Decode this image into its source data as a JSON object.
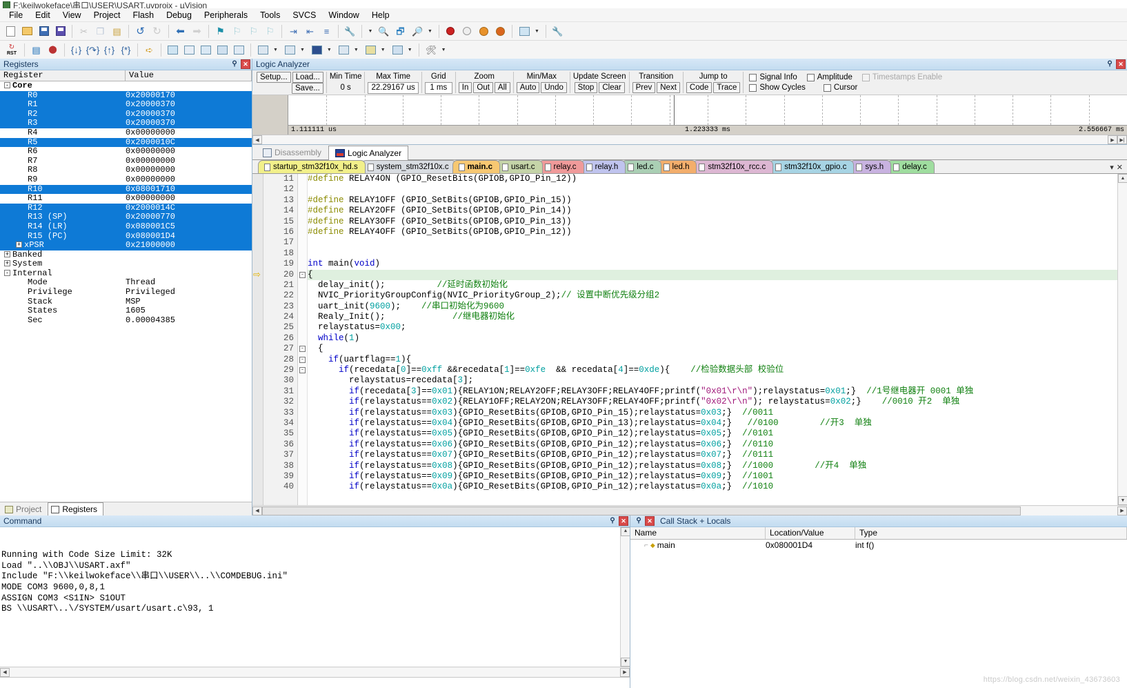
{
  "window": {
    "title": "F:\\keilwokeface\\串口\\USER\\USART.uvprojx - µVision",
    "logo_icon": "keil-logo-icon"
  },
  "menu": {
    "items": [
      {
        "label": "File"
      },
      {
        "label": "Edit"
      },
      {
        "label": "View"
      },
      {
        "label": "Project"
      },
      {
        "label": "Flash"
      },
      {
        "label": "Debug"
      },
      {
        "label": "Peripherals"
      },
      {
        "label": "Tools"
      },
      {
        "label": "SVCS"
      },
      {
        "label": "Window"
      },
      {
        "label": "Help"
      }
    ]
  },
  "toolbar_main": {
    "buttons": [
      {
        "name": "new-file-icon",
        "glyph": "doc"
      },
      {
        "name": "open-file-icon",
        "glyph": "folder"
      },
      {
        "name": "save-icon",
        "glyph": "save"
      },
      {
        "name": "save-all-icon",
        "glyph": "saveall"
      },
      {
        "name": "cut-icon",
        "glyph": "cut"
      },
      {
        "name": "copy-icon",
        "glyph": "copy"
      },
      {
        "name": "paste-icon",
        "glyph": "paste"
      },
      {
        "name": "undo-icon",
        "glyph": "undo"
      },
      {
        "name": "redo-icon",
        "glyph": "redo"
      },
      {
        "name": "navigate-back-icon",
        "glyph": "back"
      },
      {
        "name": "navigate-forward-icon",
        "glyph": "forward"
      },
      {
        "name": "bookmark-toggle-icon",
        "glyph": "flag"
      },
      {
        "name": "bookmark-prev-icon",
        "glyph": "flagprev"
      },
      {
        "name": "bookmark-next-icon",
        "glyph": "flagnext"
      },
      {
        "name": "bookmark-clear-icon",
        "glyph": "flagclear"
      },
      {
        "name": "indent-icon",
        "glyph": "indent"
      },
      {
        "name": "outdent-icon",
        "glyph": "outdent"
      },
      {
        "name": "comment-icon",
        "glyph": "comment"
      },
      {
        "name": "configure-icon",
        "glyph": "cfg"
      },
      {
        "name": "find-in-files-icon",
        "glyph": "findfiles"
      },
      {
        "name": "browse-icon",
        "glyph": "browse"
      },
      {
        "name": "find-icon",
        "glyph": "find"
      },
      {
        "name": "insert-breakpoint-icon",
        "glyph": "bpred"
      },
      {
        "name": "disable-breakpoint-icon",
        "glyph": "bpgray"
      },
      {
        "name": "disable-all-breakpoints-icon",
        "glyph": "bporange1"
      },
      {
        "name": "kill-all-breakpoints-icon",
        "glyph": "bporange2"
      },
      {
        "name": "debug-window-icon",
        "glyph": "dbgwin"
      },
      {
        "name": "configure-target-icon",
        "glyph": "wrench"
      }
    ]
  },
  "toolbar_debug": {
    "buttons": [
      {
        "name": "reset-cpu-icon",
        "glyph": "rst",
        "label": "RST"
      },
      {
        "name": "run-icon",
        "glyph": "run"
      },
      {
        "name": "stop-icon",
        "glyph": "stop"
      },
      {
        "name": "step-icon",
        "glyph": "step"
      },
      {
        "name": "step-over-icon",
        "glyph": "stepover"
      },
      {
        "name": "step-out-icon",
        "glyph": "stepout"
      },
      {
        "name": "run-to-cursor-icon",
        "glyph": "runtocursor"
      },
      {
        "name": "show-next-statement-icon",
        "glyph": "nextstmt"
      },
      {
        "name": "command-window-icon",
        "glyph": "cmdwin"
      },
      {
        "name": "disassembly-window-icon",
        "glyph": "disasm"
      },
      {
        "name": "symbols-window-icon",
        "glyph": "symbols"
      },
      {
        "name": "registers-window-icon",
        "glyph": "regs"
      },
      {
        "name": "call-stack-window-icon",
        "glyph": "callstack"
      },
      {
        "name": "watch-windows-icon",
        "glyph": "watch"
      },
      {
        "name": "memory-windows-icon",
        "glyph": "memory"
      },
      {
        "name": "serial-windows-icon",
        "glyph": "serial"
      },
      {
        "name": "analysis-windows-icon",
        "glyph": "analysis"
      },
      {
        "name": "trace-windows-icon",
        "glyph": "trace"
      },
      {
        "name": "system-viewer-icon",
        "glyph": "sysview"
      },
      {
        "name": "toolbox-icon",
        "glyph": "toolbox"
      }
    ]
  },
  "registers_panel": {
    "title": "Registers",
    "columns": [
      "Register",
      "Value"
    ],
    "rows": [
      {
        "name": "Core",
        "value": "",
        "level": 0,
        "toggle": "-",
        "selected": false,
        "bold": true
      },
      {
        "name": "R0",
        "value": "0x20000170",
        "level": 2,
        "selected": true
      },
      {
        "name": "R1",
        "value": "0x20000370",
        "level": 2,
        "selected": true
      },
      {
        "name": "R2",
        "value": "0x20000370",
        "level": 2,
        "selected": true
      },
      {
        "name": "R3",
        "value": "0x20000370",
        "level": 2,
        "selected": true
      },
      {
        "name": "R4",
        "value": "0x00000000",
        "level": 2,
        "selected": false
      },
      {
        "name": "R5",
        "value": "0x2000010C",
        "level": 2,
        "selected": true
      },
      {
        "name": "R6",
        "value": "0x00000000",
        "level": 2,
        "selected": false
      },
      {
        "name": "R7",
        "value": "0x00000000",
        "level": 2,
        "selected": false
      },
      {
        "name": "R8",
        "value": "0x00000000",
        "level": 2,
        "selected": false
      },
      {
        "name": "R9",
        "value": "0x00000000",
        "level": 2,
        "selected": false
      },
      {
        "name": "R10",
        "value": "0x08001710",
        "level": 2,
        "selected": true
      },
      {
        "name": "R11",
        "value": "0x00000000",
        "level": 2,
        "selected": false
      },
      {
        "name": "R12",
        "value": "0x2000014C",
        "level": 2,
        "selected": true
      },
      {
        "name": "R13 (SP)",
        "value": "0x20000770",
        "level": 2,
        "selected": true
      },
      {
        "name": "R14 (LR)",
        "value": "0x080001C5",
        "level": 2,
        "selected": true
      },
      {
        "name": "R15 (PC)",
        "value": "0x080001D4",
        "level": 2,
        "selected": true
      },
      {
        "name": "xPSR",
        "value": "0x21000000",
        "level": 1,
        "toggle": "+",
        "selected": true
      },
      {
        "name": "Banked",
        "value": "",
        "level": 0,
        "toggle": "+",
        "selected": false
      },
      {
        "name": "System",
        "value": "",
        "level": 0,
        "toggle": "+",
        "selected": false
      },
      {
        "name": "Internal",
        "value": "",
        "level": 0,
        "toggle": "-",
        "selected": false
      },
      {
        "name": "Mode",
        "value": "Thread",
        "level": 2,
        "selected": false
      },
      {
        "name": "Privilege",
        "value": "Privileged",
        "level": 2,
        "selected": false
      },
      {
        "name": "Stack",
        "value": "MSP",
        "level": 2,
        "selected": false
      },
      {
        "name": "States",
        "value": "1605",
        "level": 2,
        "selected": false
      },
      {
        "name": "Sec",
        "value": "0.00004385",
        "level": 2,
        "selected": false
      }
    ],
    "tabs": [
      {
        "label": "Project",
        "icon": "project-icon",
        "active": false
      },
      {
        "label": "Registers",
        "icon": "registers-icon",
        "active": true
      }
    ]
  },
  "logic_analyzer": {
    "title": "Logic Analyzer",
    "setup_button": "Setup...",
    "load_button": "Load...",
    "save_button": "Save...",
    "min_time_label": "Min Time",
    "min_time_value": "0 s",
    "max_time_label": "Max Time",
    "max_time_value": "22.29167 us",
    "grid_label": "Grid",
    "grid_value": "1 ms",
    "zoom_label": "Zoom",
    "zoom_buttons": [
      "In",
      "Out",
      "All"
    ],
    "minmax_label": "Min/Max",
    "minmax_buttons": [
      "Auto",
      "Undo"
    ],
    "update_screen_label": "Update Screen",
    "update_screen_buttons": [
      "Stop",
      "Clear"
    ],
    "transition_label": "Transition",
    "transition_buttons": [
      "Prev",
      "Next"
    ],
    "jumpto_label": "Jump to",
    "jumpto_buttons": [
      "Code",
      "Trace"
    ],
    "checkboxes": [
      {
        "label": "Signal Info",
        "checked": false,
        "disabled": false
      },
      {
        "label": "Show Cycles",
        "checked": false,
        "disabled": false
      },
      {
        "label": "Amplitude",
        "checked": false,
        "disabled": false
      },
      {
        "label": "Cursor",
        "checked": false,
        "disabled": false
      },
      {
        "label": "Timestamps Enable",
        "checked": false,
        "disabled": true
      }
    ],
    "ruler": {
      "left": "1.111111 us",
      "middle": "1.223333 ms",
      "right": "2.556667 ms"
    }
  },
  "editor": {
    "view_tabs": [
      {
        "label": "Disassembly",
        "icon": "disassembly-icon",
        "active": false
      },
      {
        "label": "Logic Analyzer",
        "icon": "logic-analyzer-icon",
        "active": true
      }
    ],
    "file_tabs": [
      {
        "label": "startup_stm32f10x_hd.s",
        "color": "#f2f08a",
        "active": false
      },
      {
        "label": "system_stm32f10x.c",
        "color": "#d9dde2",
        "active": false
      },
      {
        "label": "main.c",
        "color": "#f7c872",
        "active": true
      },
      {
        "label": "usart.c",
        "color": "#c5d4a8",
        "active": false
      },
      {
        "label": "relay.c",
        "color": "#f09a9a",
        "active": false
      },
      {
        "label": "relay.h",
        "color": "#c0c4ee",
        "active": false
      },
      {
        "label": "led.c",
        "color": "#aacfb4",
        "active": false
      },
      {
        "label": "led.h",
        "color": "#f3ae6c",
        "active": false
      },
      {
        "label": "stm32f10x_rcc.c",
        "color": "#ddb7d3",
        "active": false
      },
      {
        "label": "stm32f10x_gpio.c",
        "color": "#a7d4e4",
        "active": false
      },
      {
        "label": "sys.h",
        "color": "#c8b2e0",
        "active": false
      },
      {
        "label": "delay.c",
        "color": "#9fdd9f",
        "active": false
      }
    ],
    "tab_buttons": [
      "▾",
      "✕"
    ],
    "first_line_number": 11,
    "current_line": 20,
    "lines": [
      {
        "n": 11,
        "fold": "",
        "text": "#define RELAY4ON (GPIO_ResetBits(GPIOB,GPIO_Pin_12))"
      },
      {
        "n": 12,
        "fold": "",
        "text": ""
      },
      {
        "n": 13,
        "fold": "",
        "text": "#define RELAY1OFF (GPIO_SetBits(GPIOB,GPIO_Pin_15))"
      },
      {
        "n": 14,
        "fold": "",
        "text": "#define RELAY2OFF (GPIO_SetBits(GPIOB,GPIO_Pin_14))"
      },
      {
        "n": 15,
        "fold": "",
        "text": "#define RELAY3OFF (GPIO_SetBits(GPIOB,GPIO_Pin_13))"
      },
      {
        "n": 16,
        "fold": "",
        "text": "#define RELAY4OFF (GPIO_SetBits(GPIOB,GPIO_Pin_12))"
      },
      {
        "n": 17,
        "fold": "",
        "text": ""
      },
      {
        "n": 18,
        "fold": "",
        "text": ""
      },
      {
        "n": 19,
        "fold": "",
        "text": "int main(void)"
      },
      {
        "n": 20,
        "fold": "-",
        "text": "{"
      },
      {
        "n": 21,
        "fold": "",
        "text": "  delay_init();          //延时函数初始化"
      },
      {
        "n": 22,
        "fold": "",
        "text": "  NVIC_PriorityGroupConfig(NVIC_PriorityGroup_2);// 设置中断优先级分组2"
      },
      {
        "n": 23,
        "fold": "",
        "text": "  uart_init(9600);    //串口初始化为9600"
      },
      {
        "n": 24,
        "fold": "",
        "text": "  Realy_Init();             //继电器初始化"
      },
      {
        "n": 25,
        "fold": "",
        "text": "  relaystatus=0x00;"
      },
      {
        "n": 26,
        "fold": "",
        "text": "  while(1)"
      },
      {
        "n": 27,
        "fold": "-",
        "text": "  {"
      },
      {
        "n": 28,
        "fold": "-",
        "text": "    if(uartflag==1){"
      },
      {
        "n": 29,
        "fold": "-",
        "text": "      if(recedata[0]==0xff &&recedata[1]==0xfe  && recedata[4]==0xde){    //检验数据头部 校验位"
      },
      {
        "n": 30,
        "fold": "",
        "text": "        relaystatus=recedata[3];"
      },
      {
        "n": 31,
        "fold": "",
        "text": "        if(recedata[3]==0x01){RELAY1ON;RELAY2OFF;RELAY3OFF;RELAY4OFF;printf(\"0x01\\r\\n\");relaystatus=0x01;}  //1号继电器开 0001 单独"
      },
      {
        "n": 32,
        "fold": "",
        "text": "        if(relaystatus==0x02){RELAY1OFF;RELAY2ON;RELAY3OFF;RELAY4OFF;printf(\"0x02\\r\\n\"); relaystatus=0x02;}    //0010 开2  单独"
      },
      {
        "n": 33,
        "fold": "",
        "text": "        if(relaystatus==0x03){GPIO_ResetBits(GPIOB,GPIO_Pin_15);relaystatus=0x03;}  //0011"
      },
      {
        "n": 34,
        "fold": "",
        "text": "        if(relaystatus==0x04){GPIO_ResetBits(GPIOB,GPIO_Pin_13);relaystatus=0x04;}   //0100        //开3  单独"
      },
      {
        "n": 35,
        "fold": "",
        "text": "        if(relaystatus==0x05){GPIO_ResetBits(GPIOB,GPIO_Pin_12);relaystatus=0x05;}  //0101"
      },
      {
        "n": 36,
        "fold": "",
        "text": "        if(relaystatus==0x06){GPIO_ResetBits(GPIOB,GPIO_Pin_12);relaystatus=0x06;}  //0110"
      },
      {
        "n": 37,
        "fold": "",
        "text": "        if(relaystatus==0x07){GPIO_ResetBits(GPIOB,GPIO_Pin_12);relaystatus=0x07;}  //0111"
      },
      {
        "n": 38,
        "fold": "",
        "text": "        if(relaystatus==0x08){GPIO_ResetBits(GPIOB,GPIO_Pin_12);relaystatus=0x08;}  //1000        //开4  单独"
      },
      {
        "n": 39,
        "fold": "",
        "text": "        if(relaystatus==0x09){GPIO_ResetBits(GPIOB,GPIO_Pin_12);relaystatus=0x09;}  //1001"
      },
      {
        "n": 40,
        "fold": "",
        "text": "        if(relaystatus==0x0a){GPIO_ResetBits(GPIOB,GPIO_Pin_12);relaystatus=0x0a;}  //1010"
      }
    ]
  },
  "command_panel": {
    "title": "Command",
    "lines": [
      "Running with Code Size Limit: 32K",
      "Load \"..\\\\OBJ\\\\USART.axf\"",
      "Include \"F:\\\\keilwokeface\\\\串口\\\\USER\\\\..\\\\COMDEBUG.ini\"",
      "MODE COM3 9600,0,8,1",
      "ASSIGN COM3 <S1IN> S1OUT",
      "BS \\\\USART\\..\\/SYSTEM/usart/usart.c\\93, 1"
    ]
  },
  "call_stack_panel": {
    "title": "Call Stack + Locals",
    "columns": [
      "Name",
      "Location/Value",
      "Type"
    ],
    "rows": [
      {
        "name": "main",
        "location": "0x080001D4",
        "type": "int f()"
      }
    ]
  },
  "watermark": "https://blog.csdn.net/weixin_43673603"
}
